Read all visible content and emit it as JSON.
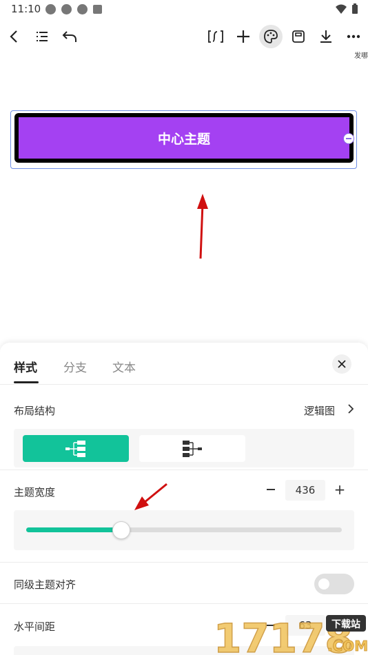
{
  "status_bar": {
    "time": "11:10"
  },
  "toolbar": {
    "cut_label": "发哪"
  },
  "canvas": {
    "central_topic": "中心主题"
  },
  "panel": {
    "tabs": [
      "样式",
      "分支",
      "文本"
    ],
    "layout": {
      "label": "布局结构",
      "value": "逻辑图"
    },
    "topic_width": {
      "label": "主题宽度",
      "value": "436",
      "slider_fraction": 0.3
    },
    "align": {
      "label": "同级主题对齐",
      "enabled": false
    },
    "h_spacing": {
      "label": "水平间距",
      "value": "63"
    }
  },
  "watermark": {
    "brand": "17178",
    "tag": "下载站",
    "domain": ".COM"
  },
  "colors": {
    "accent": "#12c39a",
    "topic_fill": "#a441f2",
    "annotation_arrow": "#d01010"
  }
}
